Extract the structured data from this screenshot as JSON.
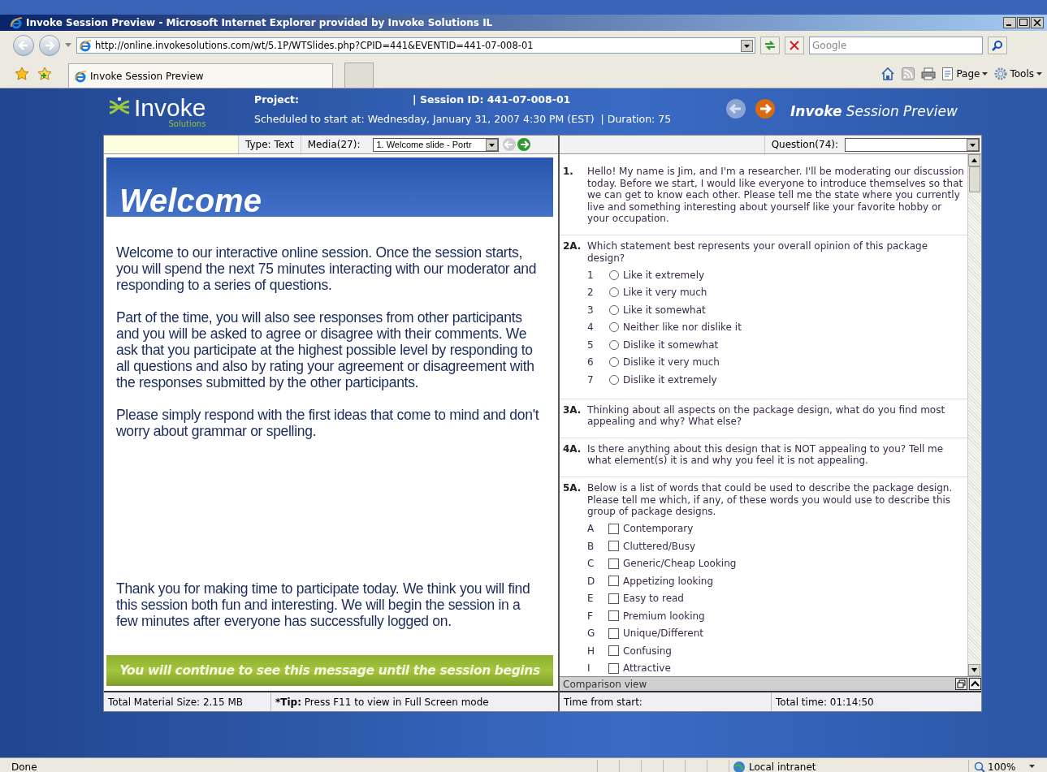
{
  "window": {
    "title": "Invoke Session Preview - Microsoft Internet Explorer provided by Invoke Solutions IL"
  },
  "address_bar": {
    "url": "http://online.invokesolutions.com/wt/5.1P/WTSlides.php?CPID=441&EVENTID=441-07-008-01"
  },
  "search": {
    "placeholder": "Google"
  },
  "tabs": [
    {
      "label": "Invoke Session Preview",
      "selected": true
    }
  ],
  "command_bar": [
    "Page",
    "Tools"
  ],
  "header": {
    "logo_name": "Invoke",
    "logo_sub": "Solutions",
    "project_label": "Project:",
    "session_id": "| Session ID: 441-07-008-01",
    "schedule": "Scheduled to start at: Wednesday, January 31, 2007 4:30 PM (EST)",
    "duration": "| Duration: 75",
    "title": "**Invoke** Session Preview"
  },
  "media_toolbar": {
    "type": "Type: Text",
    "media_label": "Media(27):",
    "media_value": "1. Welcome slide -  Portr"
  },
  "question_toolbar": {
    "label": "Question(74):"
  },
  "slide": {
    "heading": "Welcome",
    "paragraphs": [
      "Welcome to our interactive online session.  Once the session starts, you will spend the next 75 minutes interacting with our moderator and responding to a series of questions.",
      "Part of the time, you will also see responses from other participants and you will be asked to agree or disagree with their comments. We ask that you participate at the highest possible level by responding to all questions and also by rating your agreement or disagreement with the responses submitted by the other participants.",
      "Please simply respond with the first ideas that come to mind and don't worry about grammar or spelling."
    ],
    "closing": "Thank you for making time to participate today.  We think you will find this session both fun and interesting.  We will begin the session in a few minutes after everyone has successfully logged on.",
    "banner": "You will continue to see this message until the session begins"
  },
  "questions": [
    {
      "number": "1.",
      "kind": "text",
      "text": "Hello! My name is Jim, and I'm a researcher. I'll be moderating our discussion today. Before we start, I would like everyone to introduce themselves so that we can get to know each other. Please tell me the state where you currently live and something interesting about yourself like your favorite hobby or your occupation."
    },
    {
      "number": "2A.",
      "kind": "radio",
      "text": "Which statement best represents your overall opinion of this package design?",
      "options": [
        {
          "key": "1",
          "label": "Like it extremely",
          "checked": false
        },
        {
          "key": "2",
          "label": "Like it very much",
          "checked": false
        },
        {
          "key": "3",
          "label": "Like it somewhat",
          "checked": false
        },
        {
          "key": "4",
          "label": "Neither like nor dislike it",
          "checked": false
        },
        {
          "key": "5",
          "label": "Dislike it somewhat",
          "checked": false
        },
        {
          "key": "6",
          "label": "Dislike it very much",
          "checked": false
        },
        {
          "key": "7",
          "label": "Dislike it extremely",
          "checked": false
        }
      ]
    },
    {
      "number": "3A.",
      "kind": "text",
      "text": "Thinking about all aspects on the package design, what do you find most appealing and why? What else?"
    },
    {
      "number": "4A.",
      "kind": "text",
      "text": "Is there anything about this design that is NOT appealing to you? Tell me what element(s) it is and why you feel it is not appealing."
    },
    {
      "number": "5A.",
      "kind": "checkbox",
      "text": "Below is a list of words that could be used to describe the package design. Please tell me which, if any, of these words you would use to describe this group of package designs.",
      "options": [
        {
          "key": "A",
          "label": "Contemporary",
          "checked": false
        },
        {
          "key": "B",
          "label": "Cluttered/Busy",
          "checked": false
        },
        {
          "key": "C",
          "label": "Generic/Cheap Looking",
          "checked": false
        },
        {
          "key": "D",
          "label": "Appetizing looking",
          "checked": false
        },
        {
          "key": "E",
          "label": "Easy to read",
          "checked": false
        },
        {
          "key": "F",
          "label": "Premium looking",
          "checked": false
        },
        {
          "key": "G",
          "label": "Unique/Different",
          "checked": false
        },
        {
          "key": "H",
          "label": "Confusing",
          "checked": false
        },
        {
          "key": "I",
          "label": "Attractive",
          "checked": false
        }
      ]
    }
  ],
  "comparison_bar": {
    "label": "Comparison view"
  },
  "footer": {
    "material_size": "Total Material Size: 2.15 MB",
    "tip_label": "*Tip:",
    "tip_text": "Press F11 to view in Full Screen mode",
    "time_from_start": "Time from start:",
    "total_time": "Total time: 01:14:50"
  },
  "status_bar": {
    "text": "Done",
    "zone": "Local intranet",
    "zoom": "100%"
  }
}
